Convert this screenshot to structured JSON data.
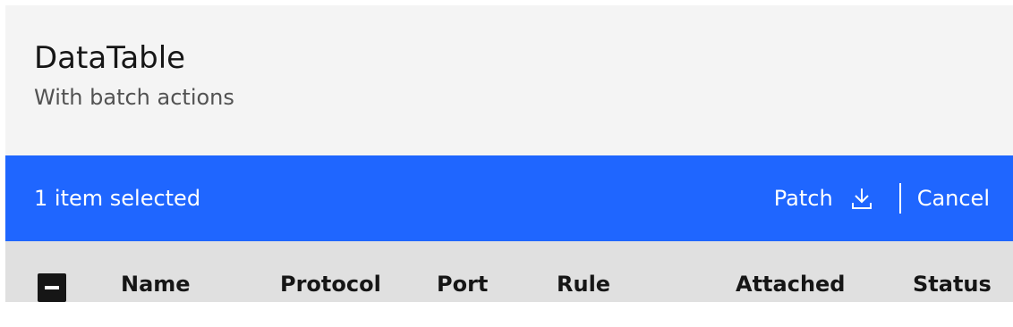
{
  "header": {
    "title": "DataTable",
    "subtitle": "With batch actions"
  },
  "batch_actions": {
    "selected_summary": "1 item selected",
    "patch_label": "Patch",
    "patch_icon": "download-icon",
    "cancel_label": "Cancel"
  },
  "table": {
    "select_all_state": "indeterminate",
    "columns": [
      "Name",
      "Protocol",
      "Port",
      "Rule",
      "Attached",
      "Status"
    ]
  },
  "colors": {
    "header_bg": "#f4f4f4",
    "batch_bar_bg": "#1f66ff",
    "thead_bg": "#e0e0e0",
    "text_primary": "#161616",
    "text_secondary": "#525252"
  }
}
